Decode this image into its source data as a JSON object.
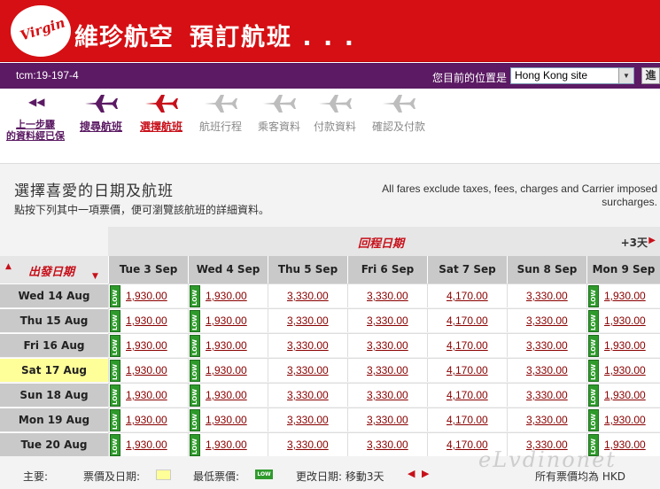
{
  "header": {
    "logo_text": "Virgin",
    "brand": "維珍航空",
    "booking_title": "預訂航班 . . ."
  },
  "subbar": {
    "tcm": "tcm:19-197-4",
    "location_label": "您目前的位置是",
    "site_value": "Hong Kong site",
    "go_label": "進"
  },
  "steps": [
    {
      "label": "上一步驟\n的資料經已保",
      "state": "back"
    },
    {
      "label": "搜尋航班",
      "state": "done"
    },
    {
      "label": "選擇航班",
      "state": "active"
    },
    {
      "label": "航班行程",
      "state": "future"
    },
    {
      "label": "乘客資料",
      "state": "future"
    },
    {
      "label": "付款資料",
      "state": "future"
    },
    {
      "label": "確認及付款",
      "state": "future"
    }
  ],
  "selection": {
    "title": "選擇喜愛的日期及航班",
    "subtitle": "點按下列其中一項票價，便可瀏覽該航班的詳細資料。",
    "fare_note": "All fares exclude taxes, fees, charges and Carrier imposed surcharges."
  },
  "grid": {
    "return_title": "回程日期",
    "next_days": "+3天",
    "depart_title": "出發日期",
    "return_dates": [
      "Tue 3 Sep",
      "Wed 4 Sep",
      "Thu 5 Sep",
      "Fri 6 Sep",
      "Sat 7 Sep",
      "Sun 8 Sep",
      "Mon 9 Sep"
    ],
    "low_columns": [
      true,
      true,
      false,
      false,
      false,
      false,
      true
    ],
    "low_label": "LOW",
    "rows": [
      {
        "date": "Wed 14 Aug",
        "selected": false,
        "prices": [
          "1,930.00",
          "1,930.00",
          "3,330.00",
          "3,330.00",
          "4,170.00",
          "3,330.00",
          "1,930.00"
        ]
      },
      {
        "date": "Thu 15 Aug",
        "selected": false,
        "prices": [
          "1,930.00",
          "1,930.00",
          "3,330.00",
          "3,330.00",
          "4,170.00",
          "3,330.00",
          "1,930.00"
        ]
      },
      {
        "date": "Fri 16 Aug",
        "selected": false,
        "prices": [
          "1,930.00",
          "1,930.00",
          "3,330.00",
          "3,330.00",
          "4,170.00",
          "3,330.00",
          "1,930.00"
        ]
      },
      {
        "date": "Sat 17 Aug",
        "selected": true,
        "prices": [
          "1,930.00",
          "1,930.00",
          "3,330.00",
          "3,330.00",
          "4,170.00",
          "3,330.00",
          "1,930.00"
        ]
      },
      {
        "date": "Sun 18 Aug",
        "selected": false,
        "prices": [
          "1,930.00",
          "1,930.00",
          "3,330.00",
          "3,330.00",
          "4,170.00",
          "3,330.00",
          "1,930.00"
        ]
      },
      {
        "date": "Mon 19 Aug",
        "selected": false,
        "prices": [
          "1,930.00",
          "1,930.00",
          "3,330.00",
          "3,330.00",
          "4,170.00",
          "3,330.00",
          "1,930.00"
        ]
      },
      {
        "date": "Tue 20 Aug",
        "selected": false,
        "prices": [
          "1,930.00",
          "1,930.00",
          "3,330.00",
          "3,330.00",
          "4,170.00",
          "3,330.00",
          "1,930.00"
        ]
      }
    ]
  },
  "legend": {
    "key_label": "主要:",
    "fare_date_label": "票價及日期:",
    "lowest_label": "最低票價:",
    "change_date_label": "更改日期: 移動3天",
    "currency_note": "所有票價均為 HKD"
  },
  "watermark": "eLvdinonet",
  "colors": {
    "brand_red": "#d50f13",
    "purple": "#5b1a63",
    "low_green": "#2f9a2c",
    "highlight_yellow": "#ffff99"
  }
}
